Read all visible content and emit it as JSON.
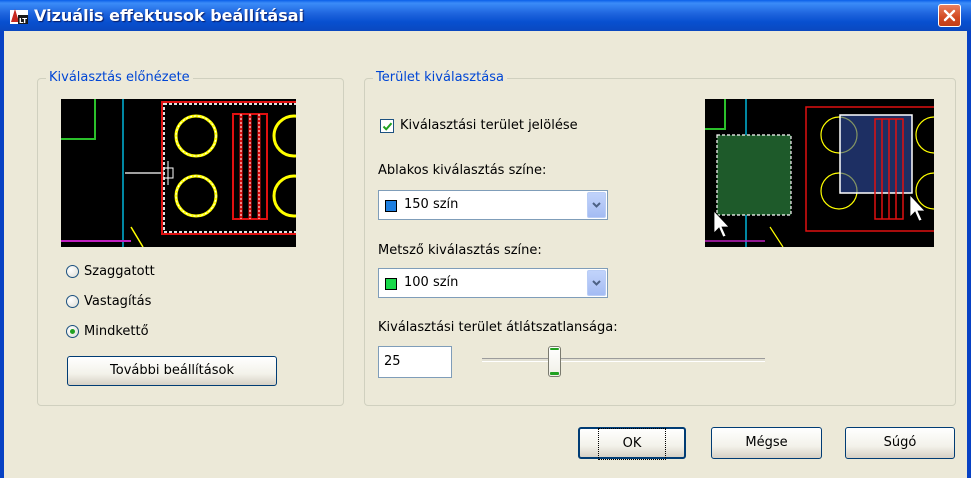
{
  "window": {
    "title": "Vizuális effektusok beállításai",
    "icon": "autocad-lt-icon",
    "close_icon": "close-icon"
  },
  "left_group": {
    "legend": "Kiválasztás előnézete",
    "radios": [
      {
        "label": "Szaggatott",
        "checked": false
      },
      {
        "label": "Vastagítás",
        "checked": false
      },
      {
        "label": "Mindkettő",
        "checked": true
      }
    ],
    "more_button": "További beállítások"
  },
  "right_group": {
    "legend": "Terület kiválasztása",
    "checkbox_label": "Kiválasztási terület jelölése",
    "checkbox_checked": true,
    "window_color_label": "Ablakos kiválasztás színe:",
    "window_color_value": "150 szín",
    "window_color_swatch": "#1E7FE0",
    "crossing_color_label": "Metsző kiválasztás színe:",
    "crossing_color_value": "100 szín",
    "crossing_color_swatch": "#19D84A",
    "opacity_label": "Kiválasztási terület átlátszatlansága:",
    "opacity_value": "25",
    "opacity_slider": 0.25
  },
  "footer": {
    "ok": "OK",
    "cancel": "Mégse",
    "help": "Súgó"
  },
  "colors": {
    "legend_text": "#0046D5",
    "title_bar": "#0A5FE8",
    "dialog_bg": "#ECE9D8"
  }
}
